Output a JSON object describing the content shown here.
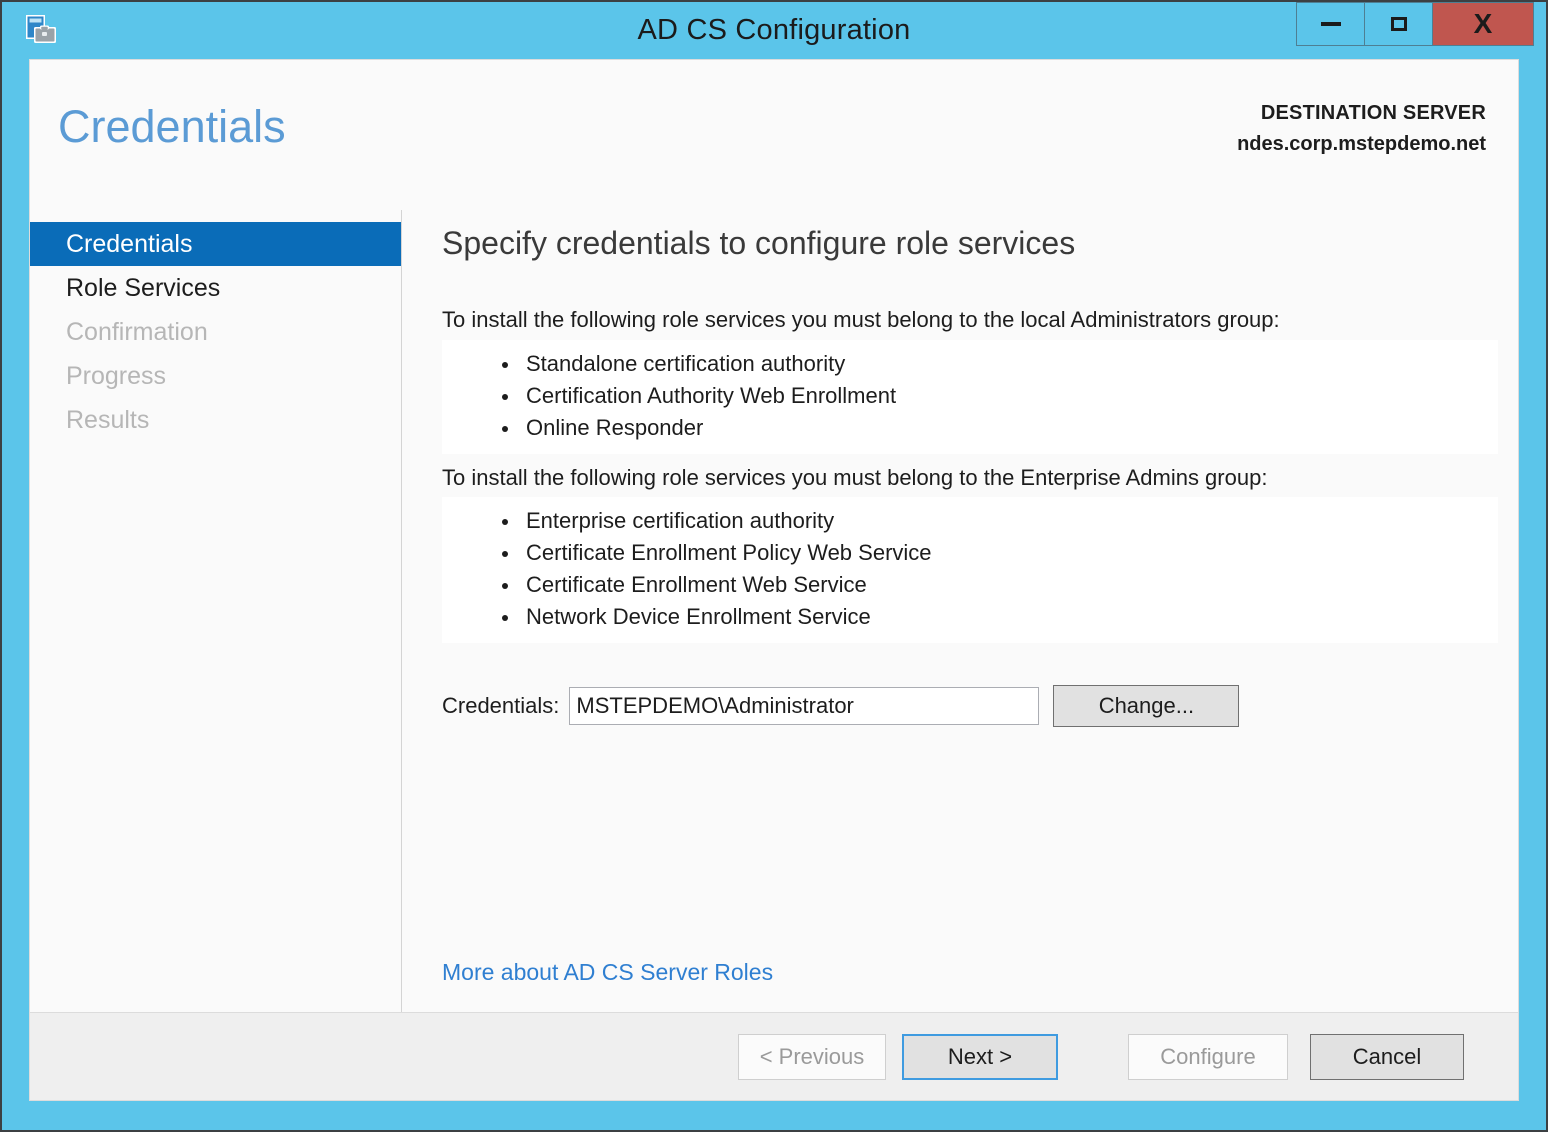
{
  "window": {
    "title": "AD CS Configuration",
    "icon": "adcs-wizard-icon",
    "controls": {
      "minimize": "minimize-icon",
      "maximize": "maximize-icon",
      "close": "X"
    },
    "frame_color": "#5BC5EA",
    "close_color": "#C0564F"
  },
  "header": {
    "page_title": "Credentials",
    "destination_label": "DESTINATION SERVER",
    "destination_server": "ndes.corp.mstepdemo.net",
    "title_color": "#5B9BD5"
  },
  "sidebar": {
    "items": [
      {
        "label": "Credentials",
        "state": "selected"
      },
      {
        "label": "Role Services",
        "state": "enabled"
      },
      {
        "label": "Confirmation",
        "state": "disabled"
      },
      {
        "label": "Progress",
        "state": "disabled"
      },
      {
        "label": "Results",
        "state": "disabled"
      }
    ],
    "selected_color": "#0A6CB8"
  },
  "main": {
    "heading": "Specify credentials to configure role services",
    "groups": [
      {
        "intro": "To install the following role services you must belong to the local Administrators group:",
        "services": [
          "Standalone certification authority",
          "Certification Authority Web Enrollment",
          "Online Responder"
        ]
      },
      {
        "intro": "To install the following role services you must belong to the Enterprise Admins group:",
        "services": [
          "Enterprise certification authority",
          "Certificate Enrollment Policy Web Service",
          "Certificate Enrollment Web Service",
          "Network Device Enrollment Service"
        ]
      }
    ],
    "credentials": {
      "label": "Credentials:",
      "value": "MSTEPDEMO\\Administrator",
      "placeholder": "",
      "change_button": "Change..."
    },
    "more_link": "More about AD CS Server Roles",
    "link_color": "#2F7FD1"
  },
  "footer": {
    "previous": "< Previous",
    "next": "Next >",
    "configure": "Configure",
    "cancel": "Cancel"
  }
}
